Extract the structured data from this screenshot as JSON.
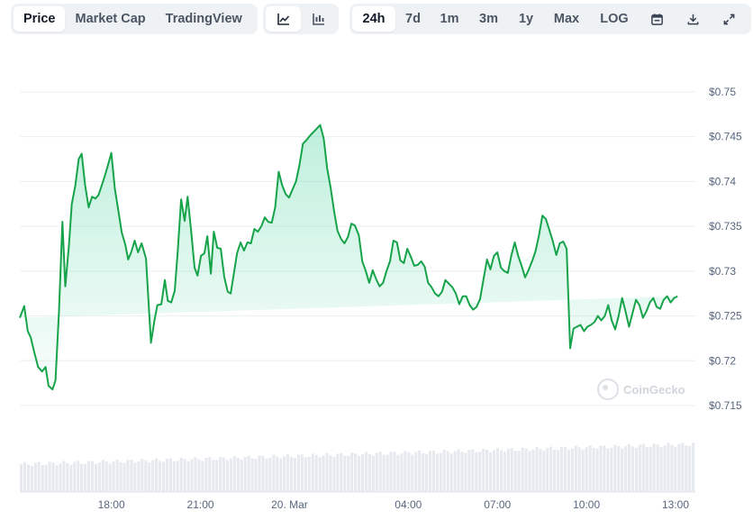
{
  "toolbar": {
    "metric_tabs": [
      {
        "label": "Price",
        "active": true
      },
      {
        "label": "Market Cap",
        "active": false
      },
      {
        "label": "TradingView",
        "active": false
      }
    ],
    "chart_type_icons": [
      {
        "icon": "line-chart-icon",
        "active": true
      },
      {
        "icon": "candlestick-chart-icon",
        "active": false
      }
    ],
    "range_tabs": [
      {
        "label": "24h",
        "active": true
      },
      {
        "label": "7d",
        "active": false
      },
      {
        "label": "1m",
        "active": false
      },
      {
        "label": "3m",
        "active": false
      },
      {
        "label": "1y",
        "active": false
      },
      {
        "label": "Max",
        "active": false
      },
      {
        "label": "LOG",
        "active": false
      }
    ],
    "tool_icons": [
      "calendar-icon",
      "download-icon",
      "expand-icon"
    ]
  },
  "watermark": {
    "text": "CoinGecko",
    "icon": "coingecko-logo-icon"
  },
  "colors": {
    "line": "#16a34a",
    "fill_top": "#16c784",
    "grid": "#eceff3",
    "volume_bar": "#e6e9ee",
    "axis_text": "#58667e",
    "toolbar_bg": "#eff2f5"
  },
  "chart_data": {
    "type": "area",
    "title": "",
    "xlabel": "",
    "ylabel": "",
    "ylim": [
      0.7148,
      0.751
    ],
    "yticks": [
      0.715,
      0.72,
      0.725,
      0.73,
      0.735,
      0.74,
      0.745,
      0.75
    ],
    "ytick_labels": [
      "$0.715",
      "$0.72",
      "$0.725",
      "$0.73",
      "$0.735",
      "$0.74",
      "$0.745",
      "$0.75"
    ],
    "xlim": [
      "2024-03-19T14:55",
      "2024-03-20T13:40"
    ],
    "xticks": [
      "2024-03-19T18:00",
      "2024-03-19T21:00",
      "2024-03-20T00:00",
      "2024-03-20T04:00",
      "2024-03-20T07:00",
      "2024-03-20T10:00",
      "2024-03-20T13:00"
    ],
    "xtick_labels": [
      "18:00",
      "21:00",
      "20. Mar",
      "04:00",
      "07:00",
      "10:00",
      "13:00"
    ],
    "grid": true,
    "y_axis_position": "right",
    "series": [
      {
        "values_x": [
          "2024-03-19T14:55",
          "2024-03-19T15:04",
          "2024-03-19T15:11",
          "2024-03-19T15:17",
          "2024-03-19T15:24",
          "2024-03-19T15:32",
          "2024-03-19T15:40",
          "2024-03-19T15:47",
          "2024-03-19T15:53",
          "2024-03-19T16:01",
          "2024-03-19T16:07",
          "2024-03-19T16:14",
          "2024-03-19T16:21",
          "2024-03-19T16:27",
          "2024-03-19T16:34",
          "2024-03-19T16:40",
          "2024-03-19T16:47",
          "2024-03-19T16:54",
          "2024-03-19T17:00",
          "2024-03-19T17:07",
          "2024-03-19T17:14",
          "2024-03-19T17:21",
          "2024-03-19T17:28",
          "2024-03-19T17:34",
          "2024-03-19T17:40",
          "2024-03-19T17:46",
          "2024-03-19T17:53",
          "2024-03-19T18:00",
          "2024-03-19T18:07",
          "2024-03-19T18:14",
          "2024-03-19T18:21",
          "2024-03-19T18:28",
          "2024-03-19T18:34",
          "2024-03-19T18:40",
          "2024-03-19T18:47",
          "2024-03-19T18:54",
          "2024-03-19T19:01",
          "2024-03-19T19:10",
          "2024-03-19T19:20",
          "2024-03-19T19:27",
          "2024-03-19T19:33",
          "2024-03-19T19:41",
          "2024-03-19T19:48",
          "2024-03-19T19:54",
          "2024-03-19T20:01",
          "2024-03-19T20:08",
          "2024-03-19T20:14",
          "2024-03-19T20:21",
          "2024-03-19T20:28",
          "2024-03-19T20:34",
          "2024-03-19T20:41",
          "2024-03-19T20:48",
          "2024-03-19T20:54",
          "2024-03-19T21:01",
          "2024-03-19T21:08",
          "2024-03-19T21:14",
          "2024-03-19T21:21",
          "2024-03-19T21:27",
          "2024-03-19T21:34",
          "2024-03-19T21:41",
          "2024-03-19T21:48",
          "2024-03-19T21:55",
          "2024-03-19T22:01",
          "2024-03-19T22:08",
          "2024-03-19T22:14",
          "2024-03-19T22:21",
          "2024-03-19T22:28",
          "2024-03-19T22:35",
          "2024-03-19T22:42",
          "2024-03-19T22:49",
          "2024-03-19T22:56",
          "2024-03-19T23:03",
          "2024-03-19T23:10",
          "2024-03-19T23:17",
          "2024-03-19T23:24",
          "2024-03-19T23:31",
          "2024-03-19T23:38",
          "2024-03-19T23:45",
          "2024-03-19T23:52",
          "2024-03-19T23:59",
          "2024-03-20T00:06",
          "2024-03-20T00:13",
          "2024-03-20T00:20",
          "2024-03-20T00:27",
          "2024-03-20T00:34",
          "2024-03-20T00:41",
          "2024-03-20T00:48",
          "2024-03-20T00:55",
          "2024-03-20T01:02",
          "2024-03-20T01:09",
          "2024-03-20T01:16",
          "2024-03-20T01:23",
          "2024-03-20T01:30",
          "2024-03-20T01:37",
          "2024-03-20T01:44",
          "2024-03-20T01:51",
          "2024-03-20T01:58",
          "2024-03-20T02:05",
          "2024-03-20T02:12",
          "2024-03-20T02:20",
          "2024-03-20T02:27",
          "2024-03-20T02:34",
          "2024-03-20T02:41",
          "2024-03-20T02:48",
          "2024-03-20T02:55",
          "2024-03-20T03:02",
          "2024-03-20T03:09",
          "2024-03-20T03:16",
          "2024-03-20T03:23",
          "2024-03-20T03:30",
          "2024-03-20T03:37",
          "2024-03-20T03:44",
          "2024-03-20T03:51",
          "2024-03-20T03:58",
          "2024-03-20T04:05",
          "2024-03-20T04:12",
          "2024-03-20T04:19",
          "2024-03-20T04:26",
          "2024-03-20T04:33",
          "2024-03-20T04:40",
          "2024-03-20T04:47",
          "2024-03-20T04:54",
          "2024-03-20T05:01",
          "2024-03-20T05:08",
          "2024-03-20T05:15",
          "2024-03-20T05:22",
          "2024-03-20T05:29",
          "2024-03-20T05:36",
          "2024-03-20T05:43",
          "2024-03-20T05:50",
          "2024-03-20T05:57",
          "2024-03-20T06:04",
          "2024-03-20T06:11",
          "2024-03-20T06:18",
          "2024-03-20T06:25",
          "2024-03-20T06:32",
          "2024-03-20T06:39",
          "2024-03-20T06:46",
          "2024-03-20T06:53",
          "2024-03-20T07:00",
          "2024-03-20T07:07",
          "2024-03-20T07:14",
          "2024-03-20T07:21",
          "2024-03-20T07:28",
          "2024-03-20T07:35",
          "2024-03-20T07:42",
          "2024-03-20T07:49",
          "2024-03-20T07:56",
          "2024-03-20T08:03",
          "2024-03-20T08:10",
          "2024-03-20T08:17",
          "2024-03-20T08:24",
          "2024-03-20T08:31",
          "2024-03-20T08:38",
          "2024-03-20T08:45",
          "2024-03-20T08:52",
          "2024-03-20T08:59",
          "2024-03-20T09:06",
          "2024-03-20T09:13",
          "2024-03-20T09:20",
          "2024-03-20T09:27",
          "2024-03-20T09:34",
          "2024-03-20T09:41",
          "2024-03-20T09:48",
          "2024-03-20T09:55",
          "2024-03-20T10:02",
          "2024-03-20T10:09",
          "2024-03-20T10:16",
          "2024-03-20T10:23",
          "2024-03-20T10:30",
          "2024-03-20T10:37",
          "2024-03-20T10:44",
          "2024-03-20T10:51",
          "2024-03-20T10:58",
          "2024-03-20T11:05",
          "2024-03-20T11:12",
          "2024-03-20T11:19",
          "2024-03-20T11:26",
          "2024-03-20T11:33",
          "2024-03-20T11:40",
          "2024-03-20T11:47",
          "2024-03-20T11:54",
          "2024-03-20T12:01",
          "2024-03-20T12:08",
          "2024-03-20T12:15",
          "2024-03-20T12:22",
          "2024-03-20T12:29",
          "2024-03-20T12:36",
          "2024-03-20T12:43",
          "2024-03-20T12:50",
          "2024-03-20T12:57",
          "2024-03-20T13:04",
          "2024-03-20T13:11",
          "2024-03-20T13:18",
          "2024-03-20T13:25",
          "2024-03-20T13:32",
          "2024-03-20T13:39"
        ],
        "values_y": [
          0.7248,
          0.7261,
          0.7233,
          0.7226,
          0.721,
          0.7193,
          0.7188,
          0.7193,
          0.7172,
          0.7168,
          0.7178,
          0.7253,
          0.7355,
          0.7283,
          0.7327,
          0.7375,
          0.7395,
          0.7425,
          0.7431,
          0.7396,
          0.7371,
          0.7383,
          0.7381,
          0.7385,
          0.7395,
          0.7405,
          0.7418,
          0.7432,
          0.7392,
          0.7368,
          0.7343,
          0.733,
          0.7313,
          0.7321,
          0.7334,
          0.7321,
          0.7331,
          0.7314,
          0.722,
          0.7245,
          0.7262,
          0.7263,
          0.729,
          0.7267,
          0.7265,
          0.7278,
          0.7322,
          0.738,
          0.7356,
          0.7383,
          0.7346,
          0.7304,
          0.7295,
          0.7317,
          0.732,
          0.7339,
          0.7297,
          0.7344,
          0.7326,
          0.7325,
          0.7294,
          0.7277,
          0.7275,
          0.7299,
          0.732,
          0.7332,
          0.7323,
          0.7332,
          0.7331,
          0.7347,
          0.7344,
          0.735,
          0.736,
          0.7355,
          0.7354,
          0.7371,
          0.7411,
          0.7396,
          0.7386,
          0.7382,
          0.7391,
          0.74,
          0.7418,
          0.7442,
          0.7446,
          0.7451,
          0.7455,
          0.7459,
          0.7463,
          0.7448,
          0.7415,
          0.7393,
          0.7367,
          0.7345,
          0.7336,
          0.7331,
          0.7338,
          0.7353,
          0.7351,
          0.734,
          0.7311,
          0.73,
          0.7287,
          0.7301,
          0.7291,
          0.7283,
          0.7287,
          0.73,
          0.7311,
          0.7334,
          0.7332,
          0.7312,
          0.7309,
          0.7325,
          0.7316,
          0.7306,
          0.7307,
          0.7311,
          0.7305,
          0.7287,
          0.7282,
          0.7275,
          0.7272,
          0.7277,
          0.729,
          0.7286,
          0.7282,
          0.7275,
          0.7263,
          0.7272,
          0.7272,
          0.7262,
          0.7257,
          0.726,
          0.7269,
          0.7291,
          0.7313,
          0.7302,
          0.7317,
          0.7321,
          0.7304,
          0.73,
          0.7298,
          0.7317,
          0.7332,
          0.7317,
          0.7306,
          0.7293,
          0.7301,
          0.7311,
          0.7322,
          0.734,
          0.7362,
          0.7358,
          0.7346,
          0.7333,
          0.7318,
          0.7331,
          0.7333,
          0.7325,
          0.7214,
          0.7236,
          0.7238,
          0.724,
          0.7233,
          0.7238,
          0.724,
          0.7243,
          0.725,
          0.7245,
          0.725,
          0.7262,
          0.7245,
          0.7235,
          0.725,
          0.727,
          0.7255,
          0.7238,
          0.7253,
          0.7268,
          0.7262,
          0.7248,
          0.7255,
          0.7265,
          0.727,
          0.726,
          0.7258,
          0.7268,
          0.7272,
          0.7265,
          0.727,
          0.7272
        ]
      }
    ],
    "volume": {
      "description": "volume bars under the price area, gradually increasing left to right",
      "ylim": [
        0,
        1
      ]
    }
  }
}
